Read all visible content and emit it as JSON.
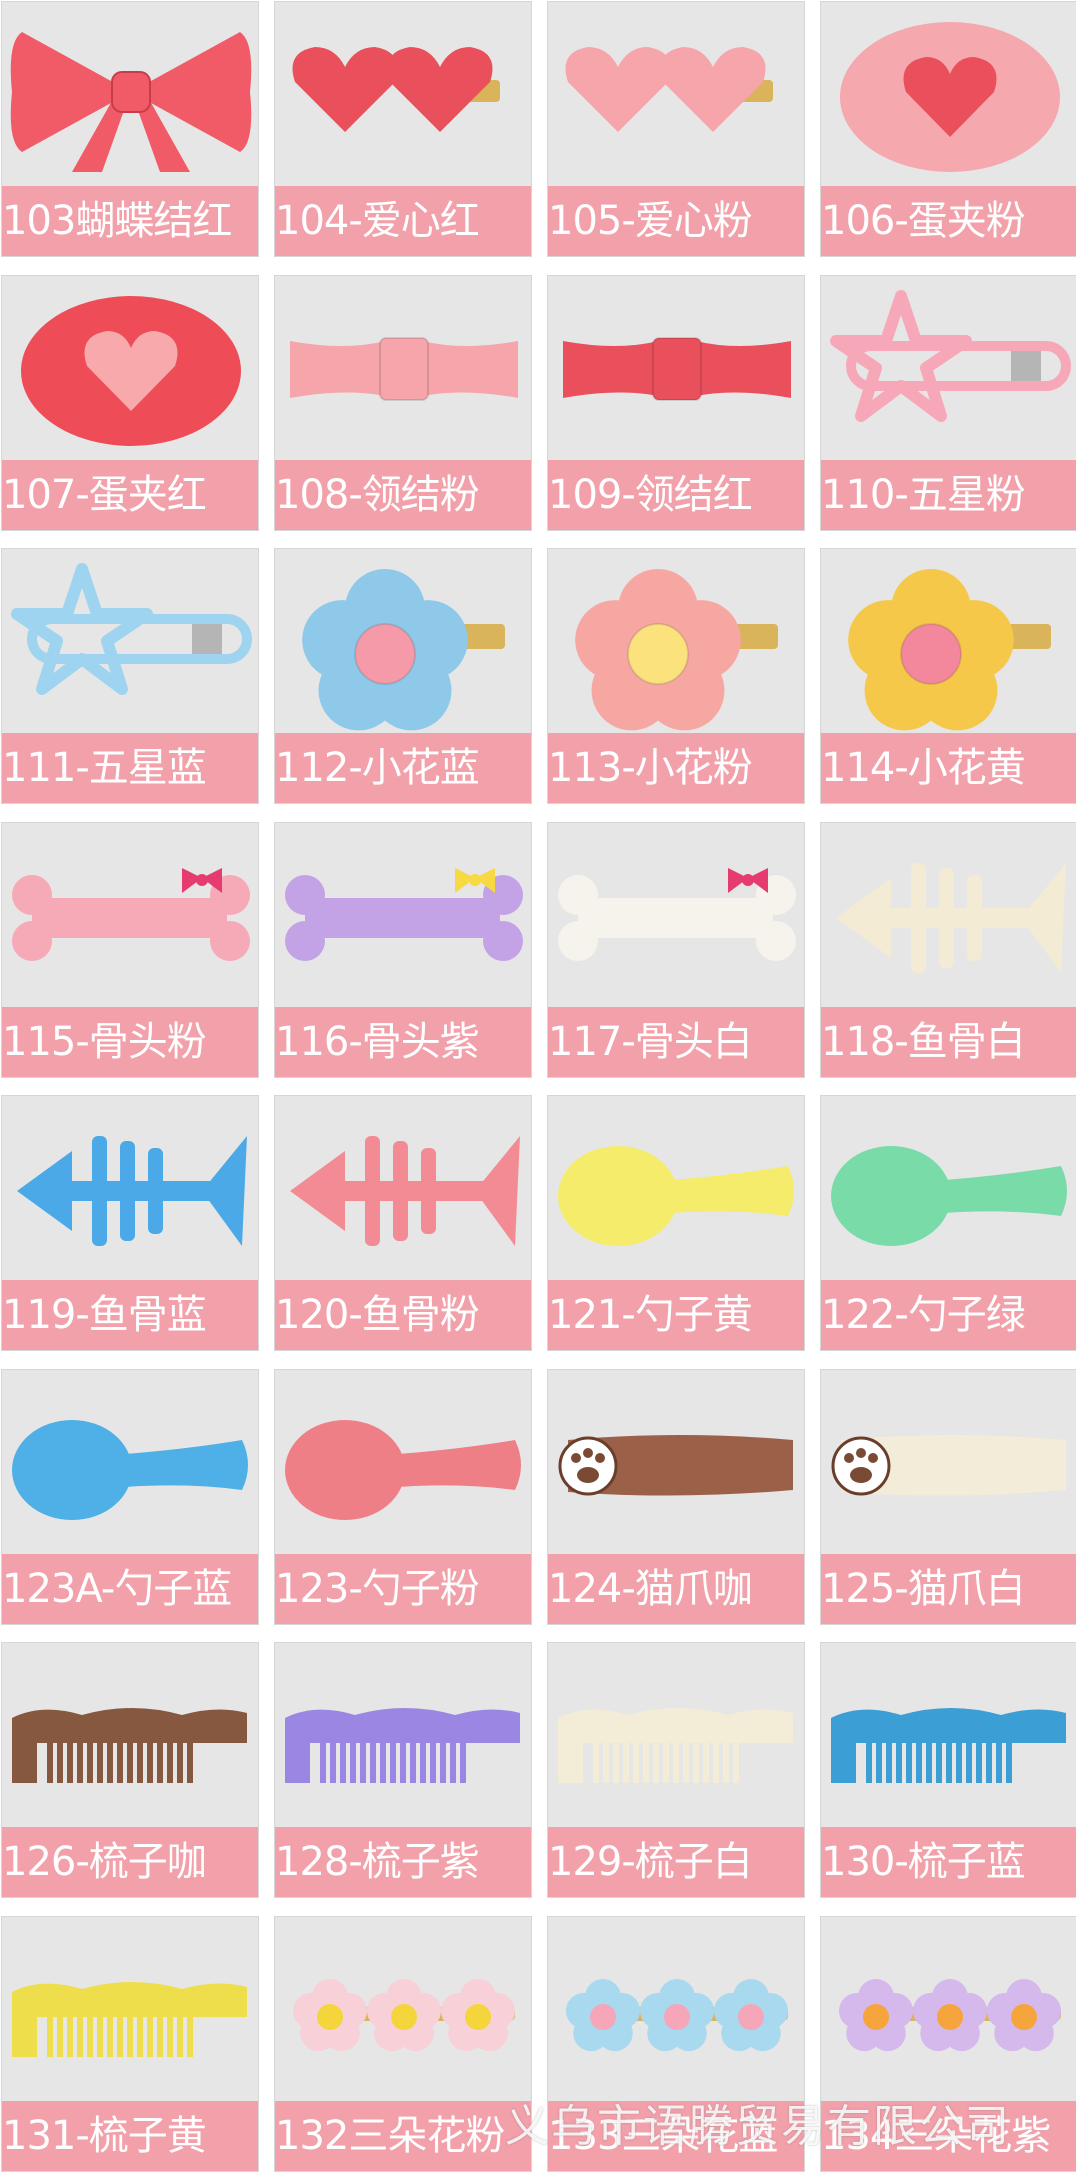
{
  "products": [
    {
      "label": "103蝴蝶结红",
      "icon": "bow-icon",
      "color": "#f15a67"
    },
    {
      "label": "104-爱心红",
      "icon": "double-heart-clip-icon",
      "color": "#e9505c"
    },
    {
      "label": "105-爱心粉",
      "icon": "double-heart-clip-icon",
      "color": "#f6a5ab"
    },
    {
      "label": "106-蛋夹粉",
      "icon": "heart-oval-clip-icon",
      "color": "#f5a8ad",
      "accent": "#e9505c"
    },
    {
      "label": "107-蛋夹红",
      "icon": "heart-oval-clip-icon",
      "color": "#ee4d57",
      "accent": "#f7a9ab"
    },
    {
      "label": "108-领结粉",
      "icon": "bowtie-clip-icon",
      "color": "#f6a5ab"
    },
    {
      "label": "109-领结红",
      "icon": "bowtie-clip-icon",
      "color": "#e9505c"
    },
    {
      "label": "110-五星粉",
      "icon": "star-clip-icon",
      "color": "#f7a8b8"
    },
    {
      "label": "111-五星蓝",
      "icon": "star-clip-icon",
      "color": "#9ed4ef"
    },
    {
      "label": "112-小花蓝",
      "icon": "flower-clip-icon",
      "color": "#8ec9ea",
      "accent": "#f49aa8"
    },
    {
      "label": "113-小花粉",
      "icon": "flower-clip-icon",
      "color": "#f7a7a2",
      "accent": "#fbe27d"
    },
    {
      "label": "114-小花黄",
      "icon": "flower-clip-icon",
      "color": "#f6c84a",
      "accent": "#f3879c"
    },
    {
      "label": "115-骨头粉",
      "icon": "bone-clip-icon",
      "color": "#f6a9b7",
      "accent": "#e53b6e"
    },
    {
      "label": "116-骨头紫",
      "icon": "bone-clip-icon",
      "color": "#c3a2e6",
      "accent": "#f7d943"
    },
    {
      "label": "117-骨头白",
      "icon": "bone-clip-icon",
      "color": "#f6f2ec",
      "accent": "#e53b6e"
    },
    {
      "label": "118-鱼骨白",
      "icon": "fishbone-clip-icon",
      "color": "#f3ebd3"
    },
    {
      "label": "119-鱼骨蓝",
      "icon": "fishbone-clip-icon",
      "color": "#4aa9e6"
    },
    {
      "label": "120-鱼骨粉",
      "icon": "fishbone-clip-icon",
      "color": "#f28b93"
    },
    {
      "label": "121-勺子黄",
      "icon": "spoon-clip-icon",
      "color": "#f5ec6c"
    },
    {
      "label": "122-勺子绿",
      "icon": "spoon-clip-icon",
      "color": "#78dba8"
    },
    {
      "label": "123A-勺子蓝",
      "icon": "spoon-clip-icon",
      "color": "#4eb0e6"
    },
    {
      "label": "123-勺子粉",
      "icon": "spoon-clip-icon",
      "color": "#ee7f86"
    },
    {
      "label": "124-猫爪咖",
      "icon": "paw-clip-icon",
      "color": "#9b6048"
    },
    {
      "label": "125-猫爪白",
      "icon": "paw-clip-icon",
      "color": "#f3ecd8"
    },
    {
      "label": "126-梳子咖",
      "icon": "comb-clip-icon",
      "color": "#86583f"
    },
    {
      "label": "128-梳子紫",
      "icon": "comb-clip-icon",
      "color": "#9b86e4"
    },
    {
      "label": "129-梳子白",
      "icon": "comb-clip-icon",
      "color": "#f3ecd6"
    },
    {
      "label": "130-梳子蓝",
      "icon": "comb-clip-icon",
      "color": "#3b9ed4"
    },
    {
      "label": "131-梳子黄",
      "icon": "comb-clip-icon",
      "color": "#eede4b"
    },
    {
      "label": "132三朵花粉",
      "icon": "three-flower-clip-icon",
      "color": "#f7d0d8",
      "accent": "#f4d53b"
    },
    {
      "label": "133三朵花蓝",
      "icon": "three-flower-clip-icon",
      "color": "#a9d9ef",
      "accent": "#f5a6b8"
    },
    {
      "label": "134三朵花紫",
      "icon": "three-flower-clip-icon",
      "color": "#d6b9ec",
      "accent": "#f5a53b"
    }
  ],
  "watermark": "义乌市语腾贸易有限公司"
}
